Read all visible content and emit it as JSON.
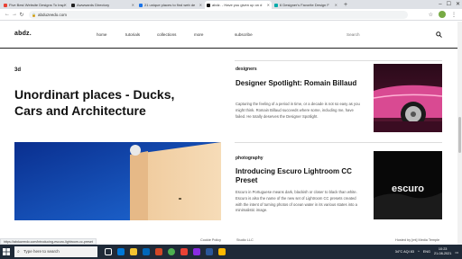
{
  "browser": {
    "tabs": [
      {
        "label": "Five Best Website Designs To Insp",
        "color": "#e94235",
        "active": false
      },
      {
        "label": "Awwwards Directory",
        "color": "#222222",
        "active": false
      },
      {
        "label": "21 unique places to find web de",
        "color": "#1a73e8",
        "active": false
      },
      {
        "label": "abdz. - Have you given up on d",
        "color": "#111111",
        "active": true
      },
      {
        "label": "6 Designer's Favorite Design F",
        "color": "#0aa",
        "active": false
      }
    ],
    "new_tab": "+",
    "url": "abduzeedo.com",
    "window_controls": [
      "–",
      "☐",
      "✕"
    ]
  },
  "site": {
    "logo": "abdz.",
    "nav": [
      "home",
      "tutorials",
      "collections",
      "more",
      "subscribe"
    ],
    "search_label": "Search"
  },
  "feature": {
    "number": "3d",
    "title": "Unordinart places - Ducks, Cars and Architecture"
  },
  "articles": [
    {
      "category": "designers",
      "title": "Designer Spotlight: Romain Billaud",
      "body": "Capturing the feeling of a period in time, or a decade is not so easy as you might think. Romain Billaud succeeds where some, including me, have failed. He totally deserves the Designer Spotlight.",
      "thumb_icon": "pink-car-image"
    },
    {
      "category": "photography",
      "title": "Introducing Escuro Lightroom CC Preset",
      "body": "Escuro in Portuguese means dark, blackish or closer to black than white. Escuro is also the name of the new set of Lightroom CC presets created with the intent of turning photos of ocean water in its various states into a minimalistic image.",
      "thumb_text": "escuro"
    }
  ],
  "footer": {
    "left": "←  →  ◆  ◆",
    "cookie": "Cookie Policy",
    "studio": "Studio LLC",
    "hosted": "Hosted by [mt] Media Temple"
  },
  "status_url": "https://abduzeedo.com/introducing-escuro-lightroom-cc-preset",
  "taskbar": {
    "search_placeholder": "Type here to search",
    "tray_text": "34°C  AQI 83",
    "lang": "ENG",
    "time": "10:23",
    "date": "21-08-2021"
  },
  "colors": {
    "taskbar": "#1f2a38",
    "accent_pink": "#c0397a"
  }
}
